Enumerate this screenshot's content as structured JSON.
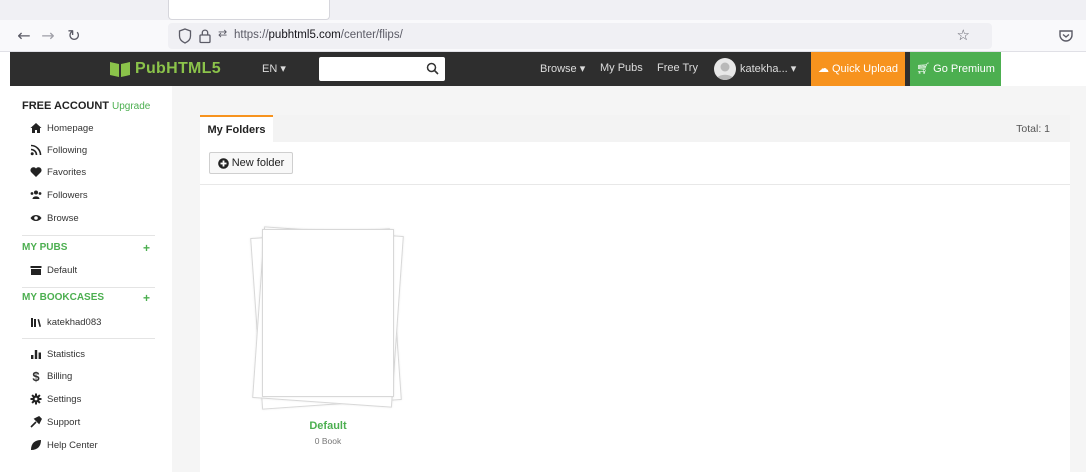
{
  "browser": {
    "url_prefix": "https://",
    "url_host": "pubhtml5.com",
    "url_path": "/center/flips/"
  },
  "header": {
    "logo_text": "PubHTML5",
    "lang": "EN ▾",
    "search_placeholder": "",
    "nav": {
      "browse": "Browse ▾",
      "my_pubs": "My Pubs",
      "free_try": "Free Try",
      "user": "katekha... ▾"
    },
    "quick_upload": "Quick Upload",
    "go_premium": "Go Premium"
  },
  "sidebar": {
    "account_label": "FREE ACCOUNT",
    "upgrade": "Upgrade",
    "main_items": [
      {
        "label": "Homepage",
        "icon": "home-icon"
      },
      {
        "label": "Following",
        "icon": "rss-icon"
      },
      {
        "label": "Favorites",
        "icon": "heart-icon"
      },
      {
        "label": "Followers",
        "icon": "users-icon"
      },
      {
        "label": "Browse",
        "icon": "eye-icon"
      }
    ],
    "my_pubs": {
      "title": "MY PUBS",
      "plus": "+",
      "items": [
        {
          "label": "Default",
          "icon": "folder-icon"
        }
      ]
    },
    "my_bookcases": {
      "title": "MY BOOKCASES",
      "plus": "+",
      "items": [
        {
          "label": "katekhad083",
          "icon": "bookcase-icon"
        }
      ]
    },
    "bottom_items": [
      {
        "label": "Statistics",
        "icon": "bar-chart-icon"
      },
      {
        "label": "Billing",
        "icon": "dollar-icon"
      },
      {
        "label": "Settings",
        "icon": "gear-icon"
      },
      {
        "label": "Support",
        "icon": "wrench-icon"
      },
      {
        "label": "Help Center",
        "icon": "leaf-icon"
      }
    ]
  },
  "main": {
    "tab_label": "My Folders",
    "total": "Total: 1",
    "new_folder": "New folder",
    "folders": [
      {
        "name": "Default",
        "count": "0 Book"
      }
    ]
  },
  "colors": {
    "accent_green": "#4caf50",
    "accent_orange": "#f7931e",
    "header_bg": "#2e2e2e"
  }
}
